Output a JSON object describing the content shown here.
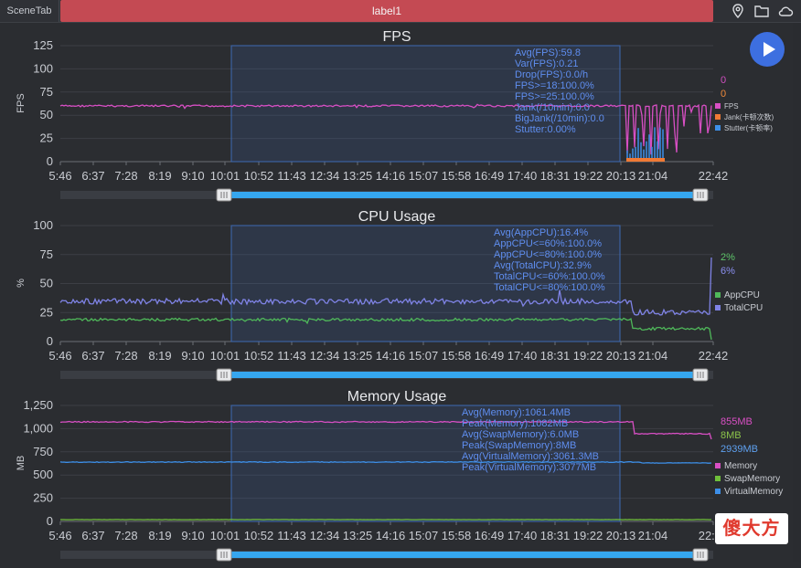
{
  "topbar": {
    "scene_tab": "SceneTab",
    "label_tab": "label1",
    "icons": [
      "location-icon",
      "folder-icon",
      "cloud-icon"
    ]
  },
  "x_axis_ticks": [
    "5:46",
    "6:37",
    "7:28",
    "8:19",
    "9:10",
    "10:01",
    "10:52",
    "11:43",
    "12:34",
    "13:25",
    "14:16",
    "15:07",
    "15:58",
    "16:49",
    "17:40",
    "18:31",
    "19:22",
    "20:13",
    "21:04",
    "22:42"
  ],
  "watermark": "傻大方",
  "panels": [
    {
      "title": "FPS",
      "ylabel": "FPS",
      "yticks": [
        "125",
        "100",
        "75",
        "50",
        "25",
        "0"
      ],
      "stats": [
        "Avg(FPS):59.8",
        "Var(FPS):0.21",
        "Drop(FPS):0.0/h",
        "FPS>=18:100.0%",
        "FPS>=25:100.0%",
        "Jank(/10min):0.0",
        "BigJank(/10min):0.0",
        "Stutter:0.00%"
      ],
      "values": [
        "0",
        "0"
      ],
      "value_colors": [
        "#d04fc0",
        "#f08a3a"
      ],
      "legend": [
        {
          "name": "FPS",
          "color": "#d84fc4"
        },
        {
          "name": "Jank(卡顿次数)",
          "color": "#f07a35"
        },
        {
          "name": "Stutter(卡顿率)",
          "color": "#3d8fe8"
        }
      ]
    },
    {
      "title": "CPU Usage",
      "ylabel": "%",
      "yticks": [
        "100",
        "75",
        "50",
        "25",
        "0"
      ],
      "stats": [
        "Avg(AppCPU):16.4%",
        "AppCPU<=60%:100.0%",
        "AppCPU<=80%:100.0%",
        "Avg(TotalCPU):32.9%",
        "TotalCPU<=60%:100.0%",
        "TotalCPU<=80%:100.0%"
      ],
      "values": [
        "2%",
        "6%"
      ],
      "value_colors": [
        "#5fc46a",
        "#8b8ff0"
      ],
      "legend": [
        {
          "name": "AppCPU",
          "color": "#4fb85a"
        },
        {
          "name": "TotalCPU",
          "color": "#7f83e6"
        }
      ]
    },
    {
      "title": "Memory Usage",
      "ylabel": "MB",
      "yticks": [
        "1,250",
        "1,000",
        "750",
        "500",
        "250",
        "0"
      ],
      "stats": [
        "Avg(Memory):1061.4MB",
        "Peak(Memory):1082MB",
        "Avg(SwapMemory):6.0MB",
        "Peak(SwapMemory):8MB",
        "Avg(VirtualMemory):3061.3MB",
        "Peak(VirtualMemory):3077MB"
      ],
      "values": [
        "855MB",
        "8MB",
        "2939MB"
      ],
      "value_colors": [
        "#d84fc4",
        "#8bc34a",
        "#5ea0ef"
      ],
      "legend": [
        {
          "name": "Memory",
          "color": "#d84fc4"
        },
        {
          "name": "SwapMemory",
          "color": "#6fbf3a"
        },
        {
          "name": "VirtualMemory",
          "color": "#3d8fe8"
        }
      ]
    }
  ]
}
